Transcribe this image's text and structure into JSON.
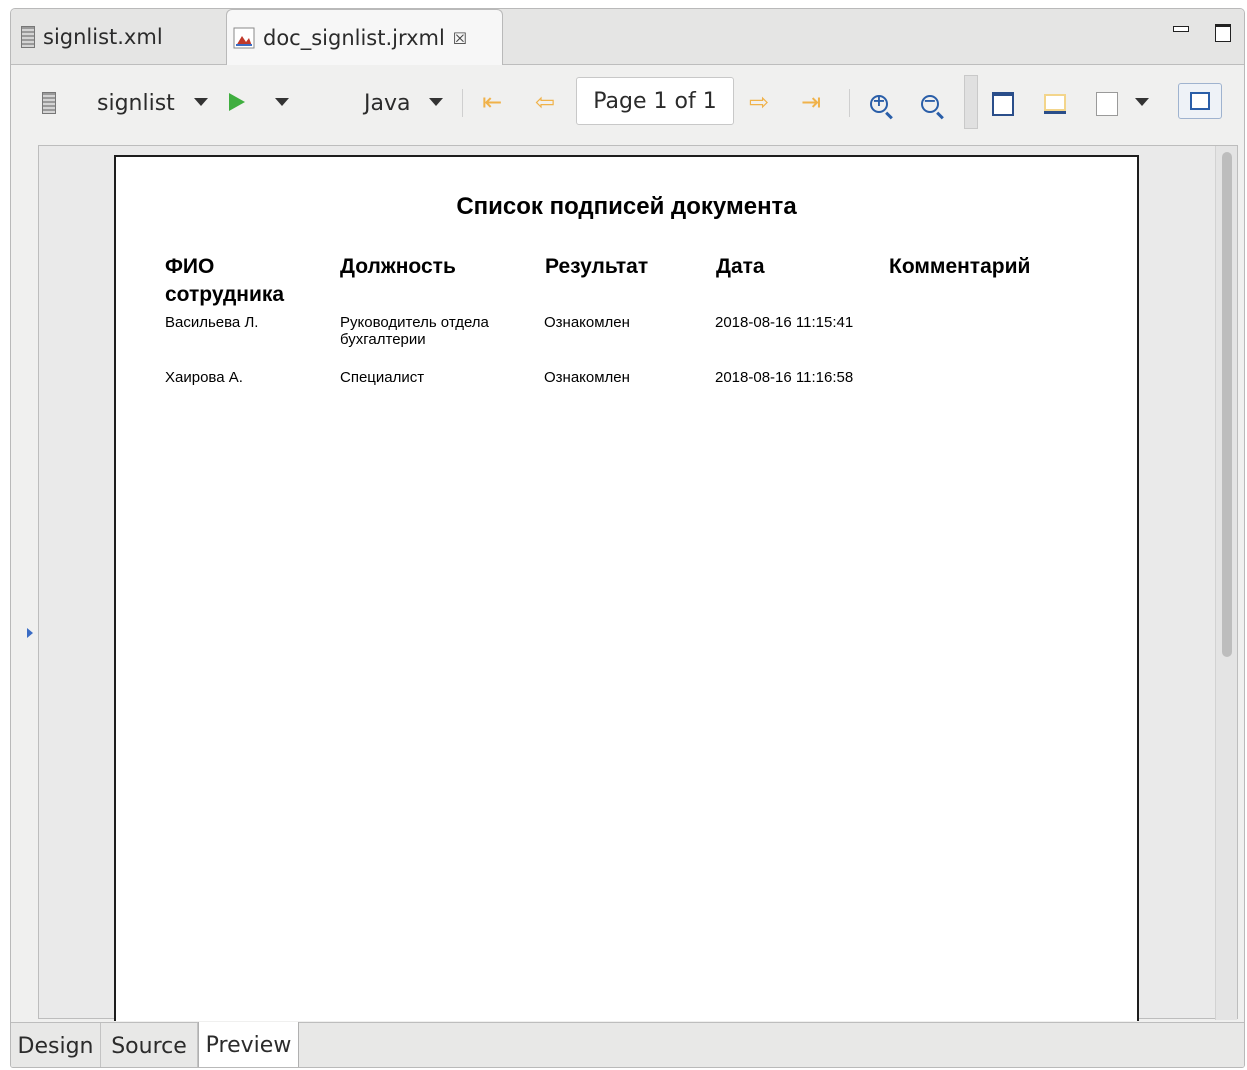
{
  "tabs": [
    {
      "label": "signlist.xml",
      "icon": "database-icon"
    },
    {
      "label": "doc_signlist.jrxml",
      "icon": "report-icon",
      "close": "☒"
    }
  ],
  "toolbar": {
    "datasource": "signlist",
    "language": "Java",
    "page_indicator": "Page 1 of 1"
  },
  "report": {
    "title": "Список подписей документа",
    "columns": [
      "ФИО сотрудника",
      "Должность",
      "Результат",
      "Дата",
      "Комментарий"
    ],
    "rows": [
      {
        "fio": "Васильева Л.",
        "position": "Руководитель отдела бухгалтерии",
        "result": "Ознакомлен",
        "date": "2018-08-16 11:15:41",
        "comment": ""
      },
      {
        "fio": "Хаирова А.",
        "position": "Специалист",
        "result": "Ознакомлен",
        "date": "2018-08-16 11:16:58",
        "comment": ""
      }
    ]
  },
  "bottom_tabs": {
    "design": "Design",
    "source": "Source",
    "preview": "Preview"
  },
  "colors": {
    "play": "#3fae3f",
    "nav_arrows": "#f0b24a",
    "zoom": "#2a5ea8"
  }
}
